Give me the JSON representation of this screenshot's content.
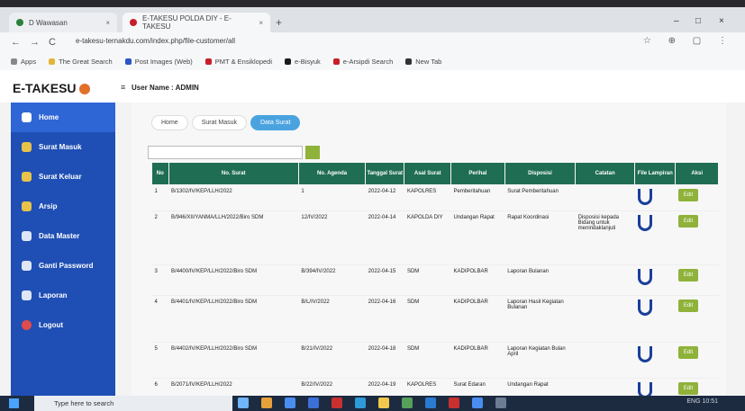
{
  "browser": {
    "tabs": [
      {
        "label": "D Wawasan",
        "color": "#2a7f3a"
      },
      {
        "label": "E-TAKESU POLDA DIY - E-TAKESU",
        "color": "#c81e2b"
      }
    ],
    "new_tab": "+",
    "window_controls": [
      "–",
      "□",
      "×"
    ],
    "nav": [
      "←",
      "→",
      "C"
    ],
    "url": "e-takesu-ternakdu.com/index.php/file-customer/all",
    "bookmarks": [
      {
        "label": "Apps",
        "color": "#888888"
      },
      {
        "label": "The Great Search",
        "color": "#e2b53a"
      },
      {
        "label": "Post Images (Web)",
        "color": "#2a56c6"
      },
      {
        "label": "PMT & Ensiklopedi",
        "color": "#c81e2b"
      },
      {
        "label": "e-Bisyuk",
        "color": "#1a1a1a"
      },
      {
        "label": "e-Arsipdi Search",
        "color": "#c81e2b"
      },
      {
        "label": "New Tab",
        "color": "#333333"
      }
    ]
  },
  "app": {
    "brand": "E-TAKESU",
    "user_label": "User Name : ADMIN",
    "sidebar": [
      {
        "label": "Home",
        "color": "#ffffff"
      },
      {
        "label": "Surat Masuk",
        "color": "#e7c34a"
      },
      {
        "label": "Surat Keluar",
        "color": "#e7c34a"
      },
      {
        "label": "Arsip",
        "color": "#e7c34a"
      },
      {
        "label": "Data Master",
        "color": "#dfe7f7"
      },
      {
        "label": "Ganti Password",
        "color": "#dfe7f7"
      },
      {
        "label": "Laporan",
        "color": "#dfe7f7"
      },
      {
        "label": "Logout",
        "color": "#e24b4b"
      }
    ],
    "breadcrumbs": [
      "Home",
      "Surat Masuk",
      "Data Surat"
    ],
    "search_placeholder": "",
    "table": {
      "headers": [
        "No",
        "No. Surat",
        "No. Agenda",
        "Tanggal Surat",
        "Asal Surat",
        "Perihal",
        "Disposisi",
        "Catatan",
        "File Lampiran",
        "Aksi"
      ],
      "rows": [
        [
          "1",
          "B/1302/IV/KEP/LLH/2022",
          "1",
          "2022-04-12",
          "KAPOLRES",
          "Pemberitahuan",
          "Surat Pemberitahuan",
          "",
          "file",
          "Edit"
        ],
        [
          "2",
          "B/946/XII/YANMA/LLH/2022/Biro SDM",
          "12/IV/2022",
          "2022-04-14",
          "KAPOLDA DIY",
          "Undangan Rapat",
          "Rapat Koordinasi",
          "Disposisi kepada Bidang untuk menindaklanjuti",
          "file",
          "Edit"
        ],
        [
          "3",
          "B/4400/IV/KEP/LLH/2022/Biro SDM",
          "B/394/IV/2022",
          "2022-04-15",
          "SDM",
          "KADIPOLBAR",
          "Laporan Bulanan",
          "",
          "file",
          "Edit"
        ],
        [
          "4",
          "B/4401/IV/KEP/LLH/2022/Biro SDM",
          "B/L/IV/2022",
          "2022-04-16",
          "SDM",
          "KADIPOLBAR",
          "Laporan Hasil Kegiatan Bulanan",
          "",
          "file",
          "Edit"
        ],
        [
          "5",
          "B/4402/IV/KEP/LLH/2022/Biro SDM",
          "B/21/IV/2022",
          "2022-04-18",
          "SDM",
          "KADIPOLBAR",
          "Laporan Kegiatan Bulan April",
          "",
          "file",
          "Edit"
        ],
        [
          "6",
          "B/2071/IV/KEP/LLH/2022",
          "B/22/IV/2022",
          "2022-04-19",
          "KAPOLRES",
          "Surat Edaran",
          "Undangan Rapat",
          "",
          "file",
          "Edit"
        ]
      ]
    }
  },
  "taskbar": {
    "search_text": "Type here to search",
    "apps": [
      "#6fb6ff",
      "#e6a23a",
      "#4a8df0",
      "#3d6fd8",
      "#c8302f",
      "#2f9ad8",
      "#f2c94c",
      "#57a05a",
      "#2a7bd0",
      "#c8302f",
      "#4a8df0",
      "#6b7c93"
    ],
    "tray": "ENG 10:51"
  }
}
